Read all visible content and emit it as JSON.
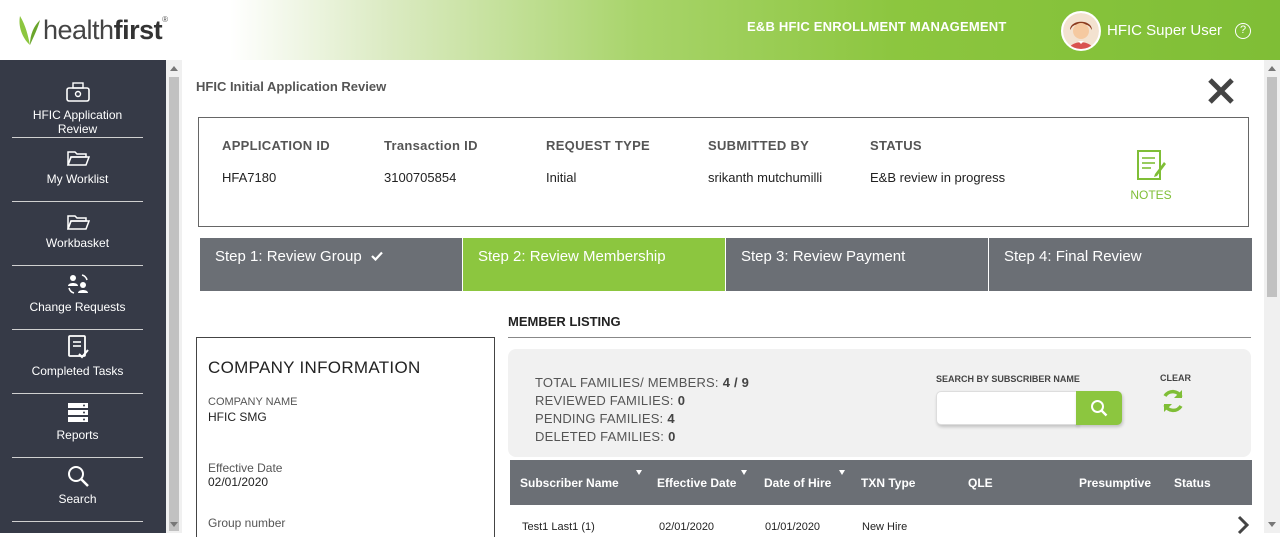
{
  "header": {
    "logo_prefix": "health",
    "logo_bold": "first",
    "logo_tm": "®",
    "app_title": "E&B HFIC ENROLLMENT MANAGEMENT",
    "user_name": "HFIC Super User",
    "help": "?"
  },
  "sidebar": {
    "items": [
      {
        "label": "HFIC Application Review",
        "icon": "cash-register-icon"
      },
      {
        "label": "My Worklist",
        "icon": "folder-open-icon"
      },
      {
        "label": "Workbasket",
        "icon": "folder-open-icon"
      },
      {
        "label": "Change Requests",
        "icon": "people-exchange-icon"
      },
      {
        "label": "Completed Tasks",
        "icon": "clipboard-check-icon"
      },
      {
        "label": "Reports",
        "icon": "server-icon"
      },
      {
        "label": "Search",
        "icon": "search-icon"
      }
    ]
  },
  "page": {
    "title": "HFIC Initial Application Review"
  },
  "application": {
    "columns": [
      {
        "header": "APPLICATION ID",
        "value": "HFA7180"
      },
      {
        "header": "Transaction ID",
        "value": "3100705854"
      },
      {
        "header": "REQUEST TYPE",
        "value": "Initial"
      },
      {
        "header": "SUBMITTED BY",
        "value": "srikanth mutchumilli"
      },
      {
        "header": "STATUS",
        "value": "E&B review in progress"
      }
    ],
    "notes_label": "NOTES"
  },
  "steps": [
    {
      "label": "Step 1: Review Group",
      "state": "complete"
    },
    {
      "label": "Step 2: Review Membership",
      "state": "active"
    },
    {
      "label": "Step 3: Review Payment",
      "state": "pending"
    },
    {
      "label": "Step 4: Final Review",
      "state": "pending"
    }
  ],
  "company": {
    "title": "COMPANY INFORMATION",
    "fields": [
      {
        "label": "COMPANY NAME",
        "value": "HFIC SMG"
      },
      {
        "label": "Effective Date",
        "value": "02/01/2020"
      },
      {
        "label": "Group number",
        "value": ""
      }
    ]
  },
  "members": {
    "title": "MEMBER LISTING",
    "summary": [
      {
        "label": "TOTAL FAMILIES/ MEMBERS:",
        "value": "4 / 9"
      },
      {
        "label": "REVIEWED FAMILIES:",
        "value": "0"
      },
      {
        "label": "PENDING FAMILIES:",
        "value": "4"
      },
      {
        "label": "DELETED FAMILIES:",
        "value": "0"
      }
    ],
    "search_label": "SEARCH BY SUBSCRIBER NAME",
    "search_value": "",
    "clear_label": "CLEAR",
    "columns": [
      "Subscriber Name",
      "Effective Date",
      "Date of Hire",
      "TXN Type",
      "QLE",
      "Presumptive",
      "Status"
    ],
    "rows": [
      {
        "subscriber": "Test1 Last1 (1)",
        "effective": "02/01/2020",
        "hire": "01/01/2020",
        "txn": "New Hire",
        "qle": "",
        "presumptive": "",
        "status": ""
      }
    ]
  },
  "colors": {
    "brand_green": "#8cc63f",
    "sidebar_bg": "#363a47",
    "step_gray": "#6b6f75"
  }
}
